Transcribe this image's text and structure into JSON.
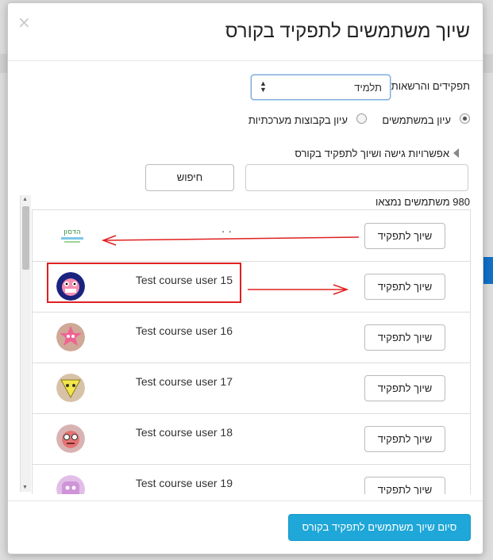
{
  "dialog": {
    "title": "שיוך משתמשים לתפקיד בקורס",
    "close_symbol": "×"
  },
  "roles": {
    "label": "תפקידים והרשאות",
    "selected": "תלמיד"
  },
  "view_mode": {
    "options": [
      {
        "label": "עיון במשתמשים",
        "selected": true
      },
      {
        "label": "עיון בקבוצות מערכתיות",
        "selected": false
      }
    ]
  },
  "access_section": {
    "label": "אפשרויות גישה ושיוך לתפקיד בקורס"
  },
  "search": {
    "value": "",
    "button_label": "חיפוש"
  },
  "results": {
    "count_text": "980 משתמשים נמצאו"
  },
  "users": [
    {
      "name": "· ·",
      "button": "שיוך לתפקיד",
      "avatar": "logo-avatar"
    },
    {
      "name": "Test course user 15",
      "button": "שיוך לתפקיד",
      "avatar": "monster-avatar"
    },
    {
      "name": "Test course user 16",
      "button": "שיוך לתפקיד",
      "avatar": "star-avatar"
    },
    {
      "name": "Test course user 17",
      "button": "שיוך לתפקיד",
      "avatar": "triangle-avatar"
    },
    {
      "name": "Test course user 18",
      "button": "שיוך לתפקיד",
      "avatar": "glasses-avatar"
    },
    {
      "name": "Test course user 19",
      "button": "שיוך לתפקיד",
      "avatar": "pink-avatar"
    }
  ],
  "footer": {
    "finish_label": "סיום שיוך משתמשים לתפקיד בקורס"
  },
  "colors": {
    "primary": "#1ea7d8",
    "annotation": "#e02020"
  }
}
